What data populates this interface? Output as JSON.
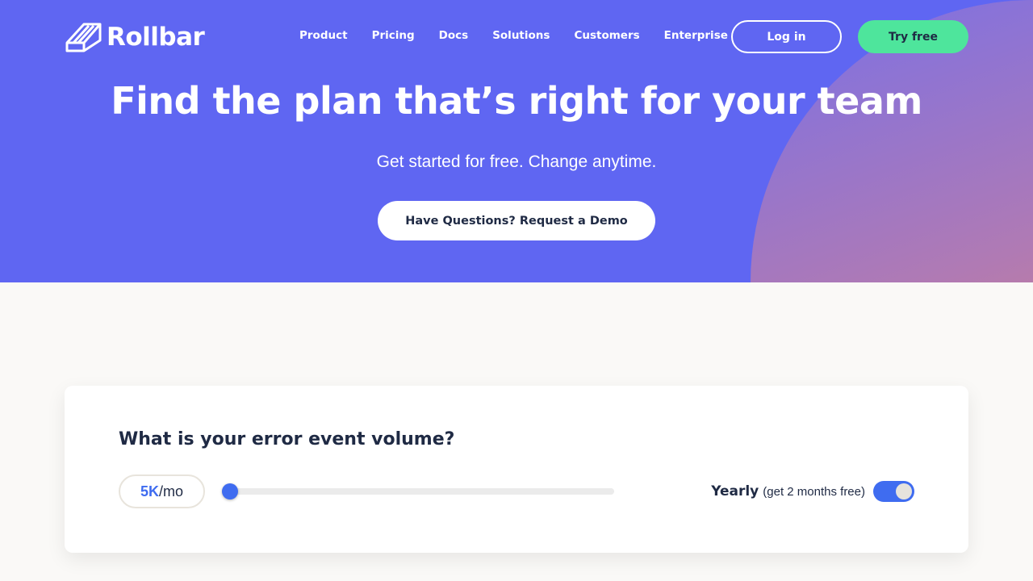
{
  "header": {
    "logo_text": "Rollbar",
    "logo_icon": "rollbar-logo-icon",
    "nav": [
      "Product",
      "Pricing",
      "Docs",
      "Solutions",
      "Customers",
      "Enterprise"
    ],
    "login_label": "Log in",
    "try_label": "Try free"
  },
  "hero": {
    "title": "Find the plan that’s right for your team",
    "subtitle": "Get started for free. Change anytime.",
    "demo_label": "Have Questions? Request a Demo"
  },
  "volume": {
    "question": "What is your error event volume?",
    "value": "5K",
    "unit": "/mo",
    "slider_fraction": 0
  },
  "billing": {
    "label": "Yearly",
    "note": "(get 2 months free)",
    "enabled": true
  },
  "colors": {
    "hero_bg": "#5f66f2",
    "accent": "#3f6cf0",
    "cta_green": "#4ee59c",
    "text_dark": "#1f2a44"
  }
}
